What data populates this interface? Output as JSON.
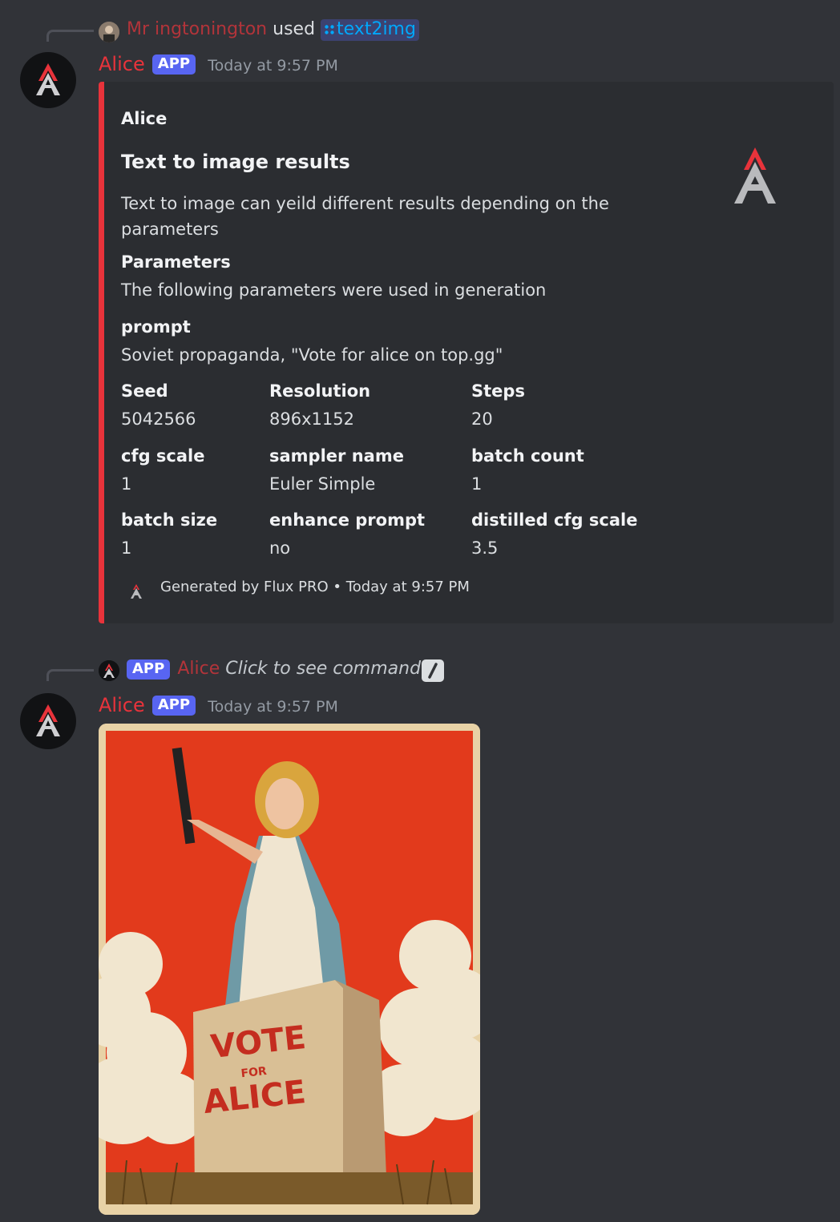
{
  "colors": {
    "accent": "#e8333b",
    "app_badge": "#5865f2",
    "link": "#00a8fc",
    "bg": "#313338",
    "embed_bg": "#2b2d31"
  },
  "message1": {
    "reply": {
      "user": "Mr ingtonington",
      "used": "used",
      "command_icon": "slash-command-icon",
      "command": "text2img"
    },
    "author": "Alice",
    "badge": "APP",
    "timestamp": "Today at 9:57 PM",
    "embed": {
      "author": "Alice",
      "title": "Text to image results",
      "description_line1": "Text to image can yeild different results depending on the",
      "description_line2": "parameters",
      "thumbnail_icon": "alice-logo-icon",
      "fields": {
        "parameters": {
          "name": "Parameters",
          "value": "The following parameters were used in generation"
        },
        "prompt": {
          "name": "prompt",
          "value": "Soviet propaganda, \"Vote for alice on top.gg\""
        },
        "seed": {
          "name": "Seed",
          "value": "5042566"
        },
        "resolution": {
          "name": "Resolution",
          "value": "896x1152"
        },
        "steps": {
          "name": "Steps",
          "value": "20"
        },
        "cfg_scale": {
          "name": "cfg scale",
          "value": "1"
        },
        "sampler_name": {
          "name": "sampler name",
          "value": "Euler Simple"
        },
        "batch_count": {
          "name": "batch count",
          "value": "1"
        },
        "batch_size": {
          "name": "batch size",
          "value": "1"
        },
        "enhance_prompt": {
          "name": "enhance prompt",
          "value": "no"
        },
        "distilled_cfg_scale": {
          "name": "distilled cfg scale",
          "value": "3.5"
        }
      },
      "footer": {
        "text": "Generated by Flux PRO",
        "separator": "•",
        "timestamp": "Today at 9:57 PM"
      }
    }
  },
  "message2": {
    "reply": {
      "badge": "APP",
      "user": "Alice",
      "action": "Click to see command"
    },
    "author": "Alice",
    "badge": "APP",
    "timestamp": "Today at 9:57 PM",
    "image": {
      "box_text_top": "VOTE",
      "box_text_mid": "FOR",
      "box_text_bottom": "ALICE"
    }
  }
}
